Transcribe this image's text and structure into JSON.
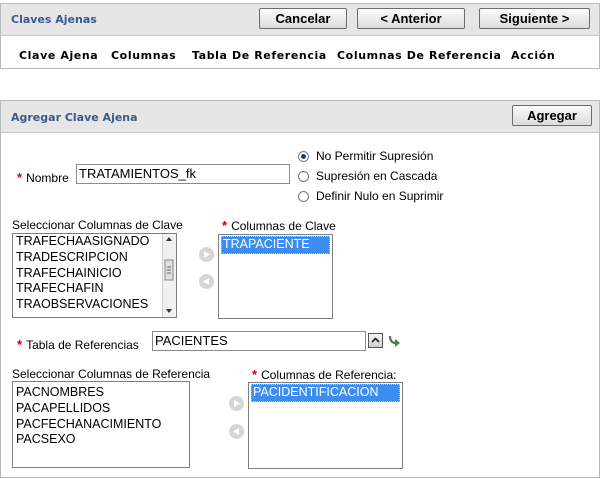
{
  "header_panel": {
    "title": "Claves Ajenas",
    "buttons": {
      "cancel": "Cancelar",
      "previous": "< Anterior",
      "next": "Siguiente >"
    },
    "columns": [
      "Clave Ajena",
      "Columnas",
      "Tabla De Referencia",
      "Columnas De Referencia",
      "Acción"
    ]
  },
  "add_panel": {
    "title": "Agregar Clave Ajena",
    "add_button": "Agregar",
    "name_label": "Nombre",
    "name_value": "TRATAMIENTOS_fk",
    "delete_options": [
      "No Permitir Supresión",
      "Supresión en Cascada",
      "Definir Nulo en Suprimir"
    ],
    "delete_selected": "No Permitir Supresión",
    "key_columns_source_label": "Seleccionar Columnas de Clave",
    "key_columns_source": [
      "TRAFECHAASIGNADO",
      "TRADESCRIPCION",
      "TRAFECHAINICIO",
      "TRAFECHAFIN",
      "TRAOBSERVACIONES"
    ],
    "key_columns_label": "Columnas de Clave",
    "key_columns": [
      "TRAPACIENTE"
    ],
    "ref_table_label": "Tabla de Referencias",
    "ref_table_value": "PACIENTES",
    "ref_columns_source_label": "Seleccionar Columnas de Referencia",
    "ref_columns_source": [
      "PACNOMBRES",
      "PACAPELLIDOS",
      "PACFECHANACIMIENTO",
      "PACSEXO"
    ],
    "ref_columns_label": "Columnas de Referencia:",
    "ref_columns": [
      "PACIDENTIFICACION"
    ]
  },
  "colors": {
    "header_bg": "#e6e6e6",
    "title_text": "#3a5a8a",
    "required": "#cc0000",
    "selection": "#3b8ef0"
  },
  "icons": [
    "arrow-right-icon",
    "arrow-left-icon",
    "list-picker-icon",
    "refresh-arrow-icon"
  ]
}
